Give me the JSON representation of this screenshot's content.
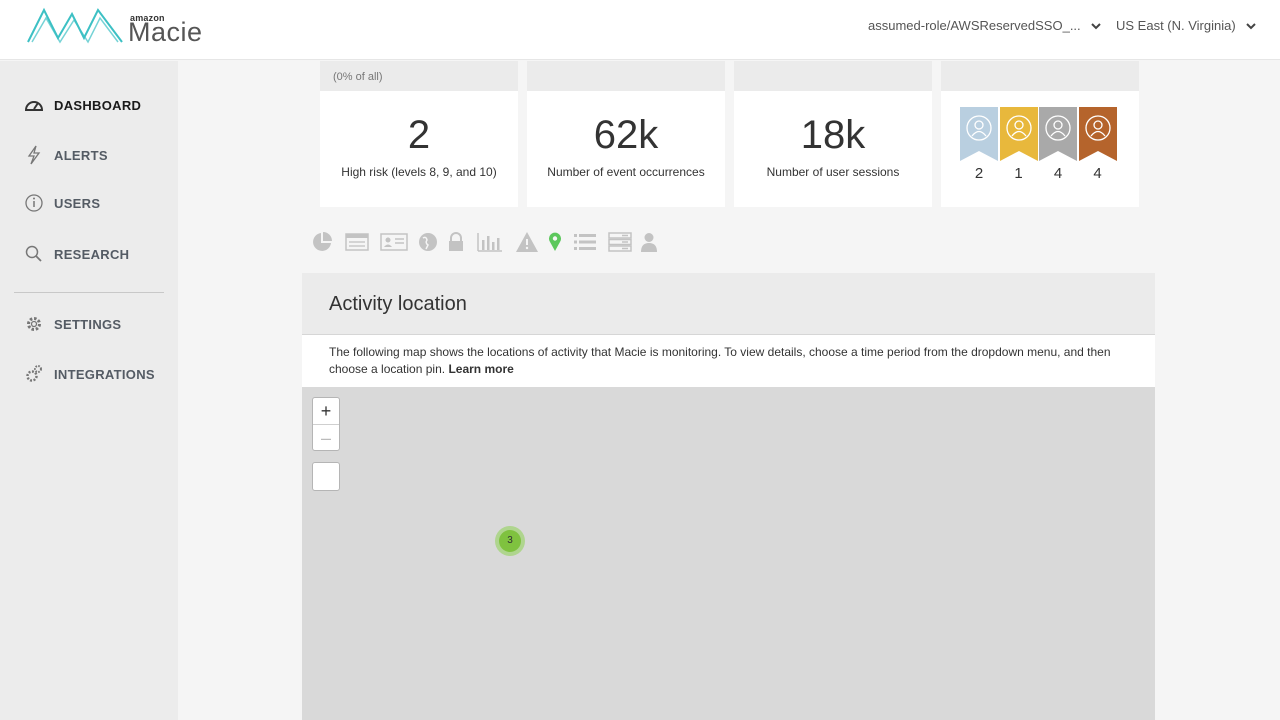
{
  "header": {
    "brand_small": "amazon",
    "brand_name": "Macie",
    "role_menu": "assumed-role/AWSReservedSSO_...",
    "region_menu": "US East (N. Virginia)"
  },
  "sidebar": {
    "items": [
      {
        "label": "DASHBOARD",
        "icon": "dashboard-gauge-icon"
      },
      {
        "label": "ALERTS",
        "icon": "lightning-icon"
      },
      {
        "label": "USERS",
        "icon": "info-circle-icon"
      },
      {
        "label": "RESEARCH",
        "icon": "search-icon"
      },
      {
        "label": "SETTINGS",
        "icon": "gear-icon"
      },
      {
        "label": "INTEGRATIONS",
        "icon": "gears-icon"
      }
    ]
  },
  "cards": [
    {
      "caption": "(0% of all)",
      "value": "2",
      "label": "High risk (levels 8, 9, and 10)"
    },
    {
      "caption": "",
      "value": "62k",
      "label": "Number of event occurrences"
    },
    {
      "caption": "",
      "value": "18k",
      "label": "Number of user sessions"
    },
    {
      "caption": ""
    }
  ],
  "user_badges": [
    {
      "count": "2",
      "color": "#b9cfe0"
    },
    {
      "count": "1",
      "color": "#e8b83c"
    },
    {
      "count": "4",
      "color": "#a9a9a9"
    },
    {
      "count": "4",
      "color": "#b5642c"
    }
  ],
  "toolbar_icons": [
    "pie-chart-icon",
    "table-list-icon",
    "id-card-icon",
    "globe-icon",
    "lock-icon",
    "bar-chart-icon",
    "warning-icon",
    "location-pin-icon",
    "list-icon",
    "server-icon",
    "user-icon"
  ],
  "colors": {
    "accent_pin": "#5dc85d",
    "brand_teal": "#3cc0c4"
  },
  "activity": {
    "title": "Activity location",
    "description": "The following map shows the locations of activity that Macie is monitoring. To view details, choose a time period from the dropdown menu, and then choose a location pin.",
    "learn_more": "Learn more"
  },
  "map": {
    "zoom_in": "+",
    "zoom_out": "–",
    "pin_count": "3"
  }
}
